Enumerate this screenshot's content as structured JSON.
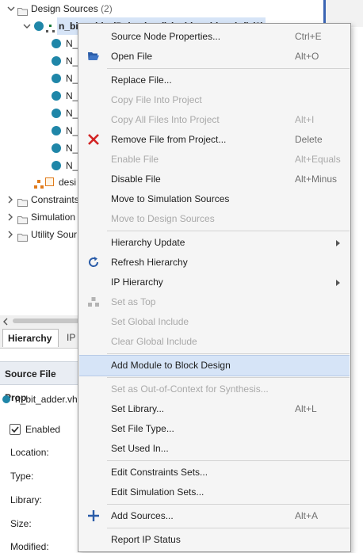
{
  "tree": {
    "design_sources": {
      "label": "Design Sources",
      "count": "(2)"
    },
    "top_node": {
      "label": "n_bit_adder(Behavioral) (n_bit_adder.vhd) (8)"
    },
    "children": [
      "N_",
      "N_",
      "N_",
      "N_",
      "N_",
      "N_",
      "N_",
      "N_"
    ],
    "design_item": "desi",
    "constraints": "Constraints",
    "simulation": "Simulation",
    "utility": "Utility Sour"
  },
  "tabs": {
    "hierarchy": "Hierarchy",
    "ip": "IP"
  },
  "source_props": {
    "title": "Source File Prop",
    "file": "n_bit_adder.vh",
    "enabled": "Enabled",
    "location": "Location:",
    "type": "Type:",
    "library": "Library:",
    "size": "Size:",
    "modified": "Modified:"
  },
  "menu": {
    "items": [
      {
        "label": "Source Node Properties...",
        "shortcut": "Ctrl+E"
      },
      {
        "label": "Open File",
        "shortcut": "Alt+O",
        "icon": "open-folder-icon"
      },
      {
        "label": "Replace File..."
      },
      {
        "label": "Copy File Into Project"
      },
      {
        "label": "Copy All Files Into Project",
        "shortcut": "Alt+I"
      },
      {
        "label": "Remove File from Project...",
        "shortcut": "Delete",
        "icon": "red-x-icon"
      },
      {
        "label": "Enable File",
        "shortcut": "Alt+Equals"
      },
      {
        "label": "Disable File",
        "shortcut": "Alt+Minus"
      },
      {
        "label": "Move to Simulation Sources"
      },
      {
        "label": "Move to Design Sources"
      },
      {
        "label": "Hierarchy Update"
      },
      {
        "label": "Refresh Hierarchy",
        "icon": "refresh-icon"
      },
      {
        "label": "IP Hierarchy"
      },
      {
        "label": "Set as Top",
        "icon": "hierarchy-icon"
      },
      {
        "label": "Set Global Include"
      },
      {
        "label": "Clear Global Include"
      },
      {
        "label": "Add Module to Block Design"
      },
      {
        "label": "Set as Out-of-Context for Synthesis..."
      },
      {
        "label": "Set Library...",
        "shortcut": "Alt+L"
      },
      {
        "label": "Set File Type..."
      },
      {
        "label": "Set Used In..."
      },
      {
        "label": "Edit Constraints Sets..."
      },
      {
        "label": "Edit Simulation Sets..."
      },
      {
        "label": "Add Sources...",
        "shortcut": "Alt+A",
        "icon": "plus-icon"
      },
      {
        "label": "Report IP Status"
      }
    ]
  },
  "colors": {
    "accent": "#1f86a8",
    "highlight": "#d6e4f7",
    "remove_x": "#d22323"
  }
}
